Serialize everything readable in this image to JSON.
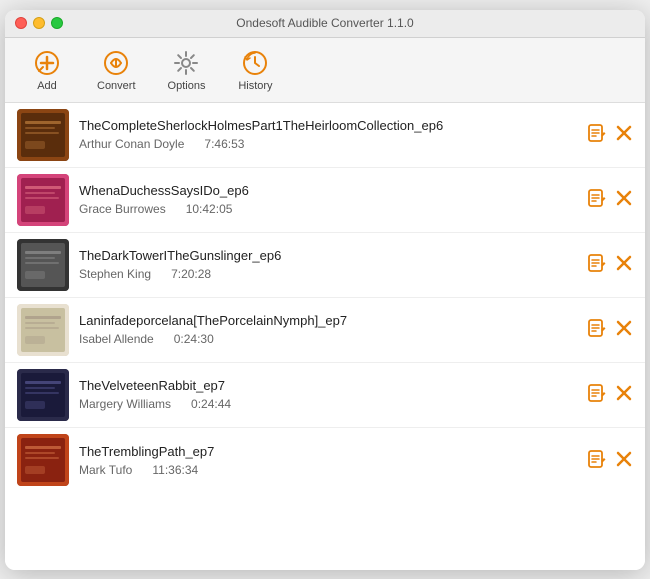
{
  "window": {
    "title": "Ondesoft Audible Converter 1.1.0"
  },
  "toolbar": {
    "items": [
      {
        "id": "add",
        "label": "Add",
        "icon": "add"
      },
      {
        "id": "convert",
        "label": "Convert",
        "icon": "convert"
      },
      {
        "id": "options",
        "label": "Options",
        "icon": "options"
      },
      {
        "id": "history",
        "label": "History",
        "icon": "history"
      }
    ]
  },
  "books": [
    {
      "id": 1,
      "title": "TheCompleteSherlockHolmesPart1TheHeirloomCollection_ep6",
      "author": "Arthur Conan Doyle",
      "duration": "7:46:53",
      "coverClass": "cover-1"
    },
    {
      "id": 2,
      "title": "WhenaDuchessSaysIDo_ep6",
      "author": "Grace Burrowes",
      "duration": "10:42:05",
      "coverClass": "cover-2"
    },
    {
      "id": 3,
      "title": "TheDarkTowerITheGunslinger_ep6",
      "author": "Stephen King",
      "duration": "7:20:28",
      "coverClass": "cover-3"
    },
    {
      "id": 4,
      "title": "Laninfadeporcelana[ThePorcelainNymph]_ep7",
      "author": "Isabel Allende",
      "duration": "0:24:30",
      "coverClass": "cover-4"
    },
    {
      "id": 5,
      "title": "TheVelveteenRabbit_ep7",
      "author": "Margery Williams",
      "duration": "0:24:44",
      "coverClass": "cover-5"
    },
    {
      "id": 6,
      "title": "TheTremblingPath_ep7",
      "author": "Mark Tufo",
      "duration": "11:36:34",
      "coverClass": "cover-6"
    }
  ],
  "actions": {
    "edit_icon": "✎",
    "delete_icon": "✕"
  }
}
